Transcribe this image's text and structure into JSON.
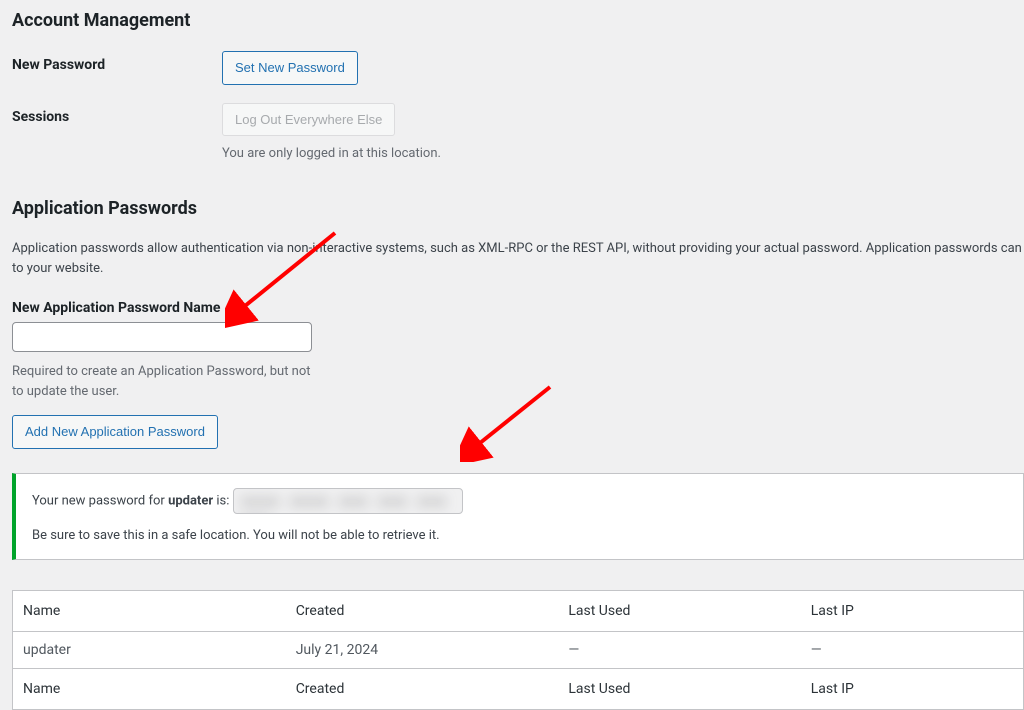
{
  "sections": {
    "account_management": {
      "title": "Account Management"
    },
    "new_password": {
      "label": "New Password",
      "button": "Set New Password"
    },
    "sessions": {
      "label": "Sessions",
      "button": "Log Out Everywhere Else",
      "description": "You are only logged in at this location."
    },
    "app_passwords": {
      "title": "Application Passwords",
      "intro": "Application passwords allow authentication via non-interactive systems, such as XML-RPC or the REST API, without providing your actual password. Application passwords can to your website.",
      "name_label": "New Application Password Name",
      "help": "Required to create an Application Password, but not to update the user.",
      "add_button": "Add New Application Password"
    },
    "notice": {
      "prefix": "Your new password for ",
      "app_name": "updater",
      "suffix": " is: ",
      "blurred_value": "XXXX XXXX XXX XXX XXX XXX",
      "warn": "Be sure to save this in a safe location. You will not be able to retrieve it."
    }
  },
  "table": {
    "headers": {
      "name": "Name",
      "created": "Created",
      "last_used": "Last Used",
      "last_ip": "Last IP"
    },
    "rows": [
      {
        "name": "updater",
        "created": "July 21, 2024",
        "last_used": "—",
        "last_ip": "—"
      }
    ]
  }
}
